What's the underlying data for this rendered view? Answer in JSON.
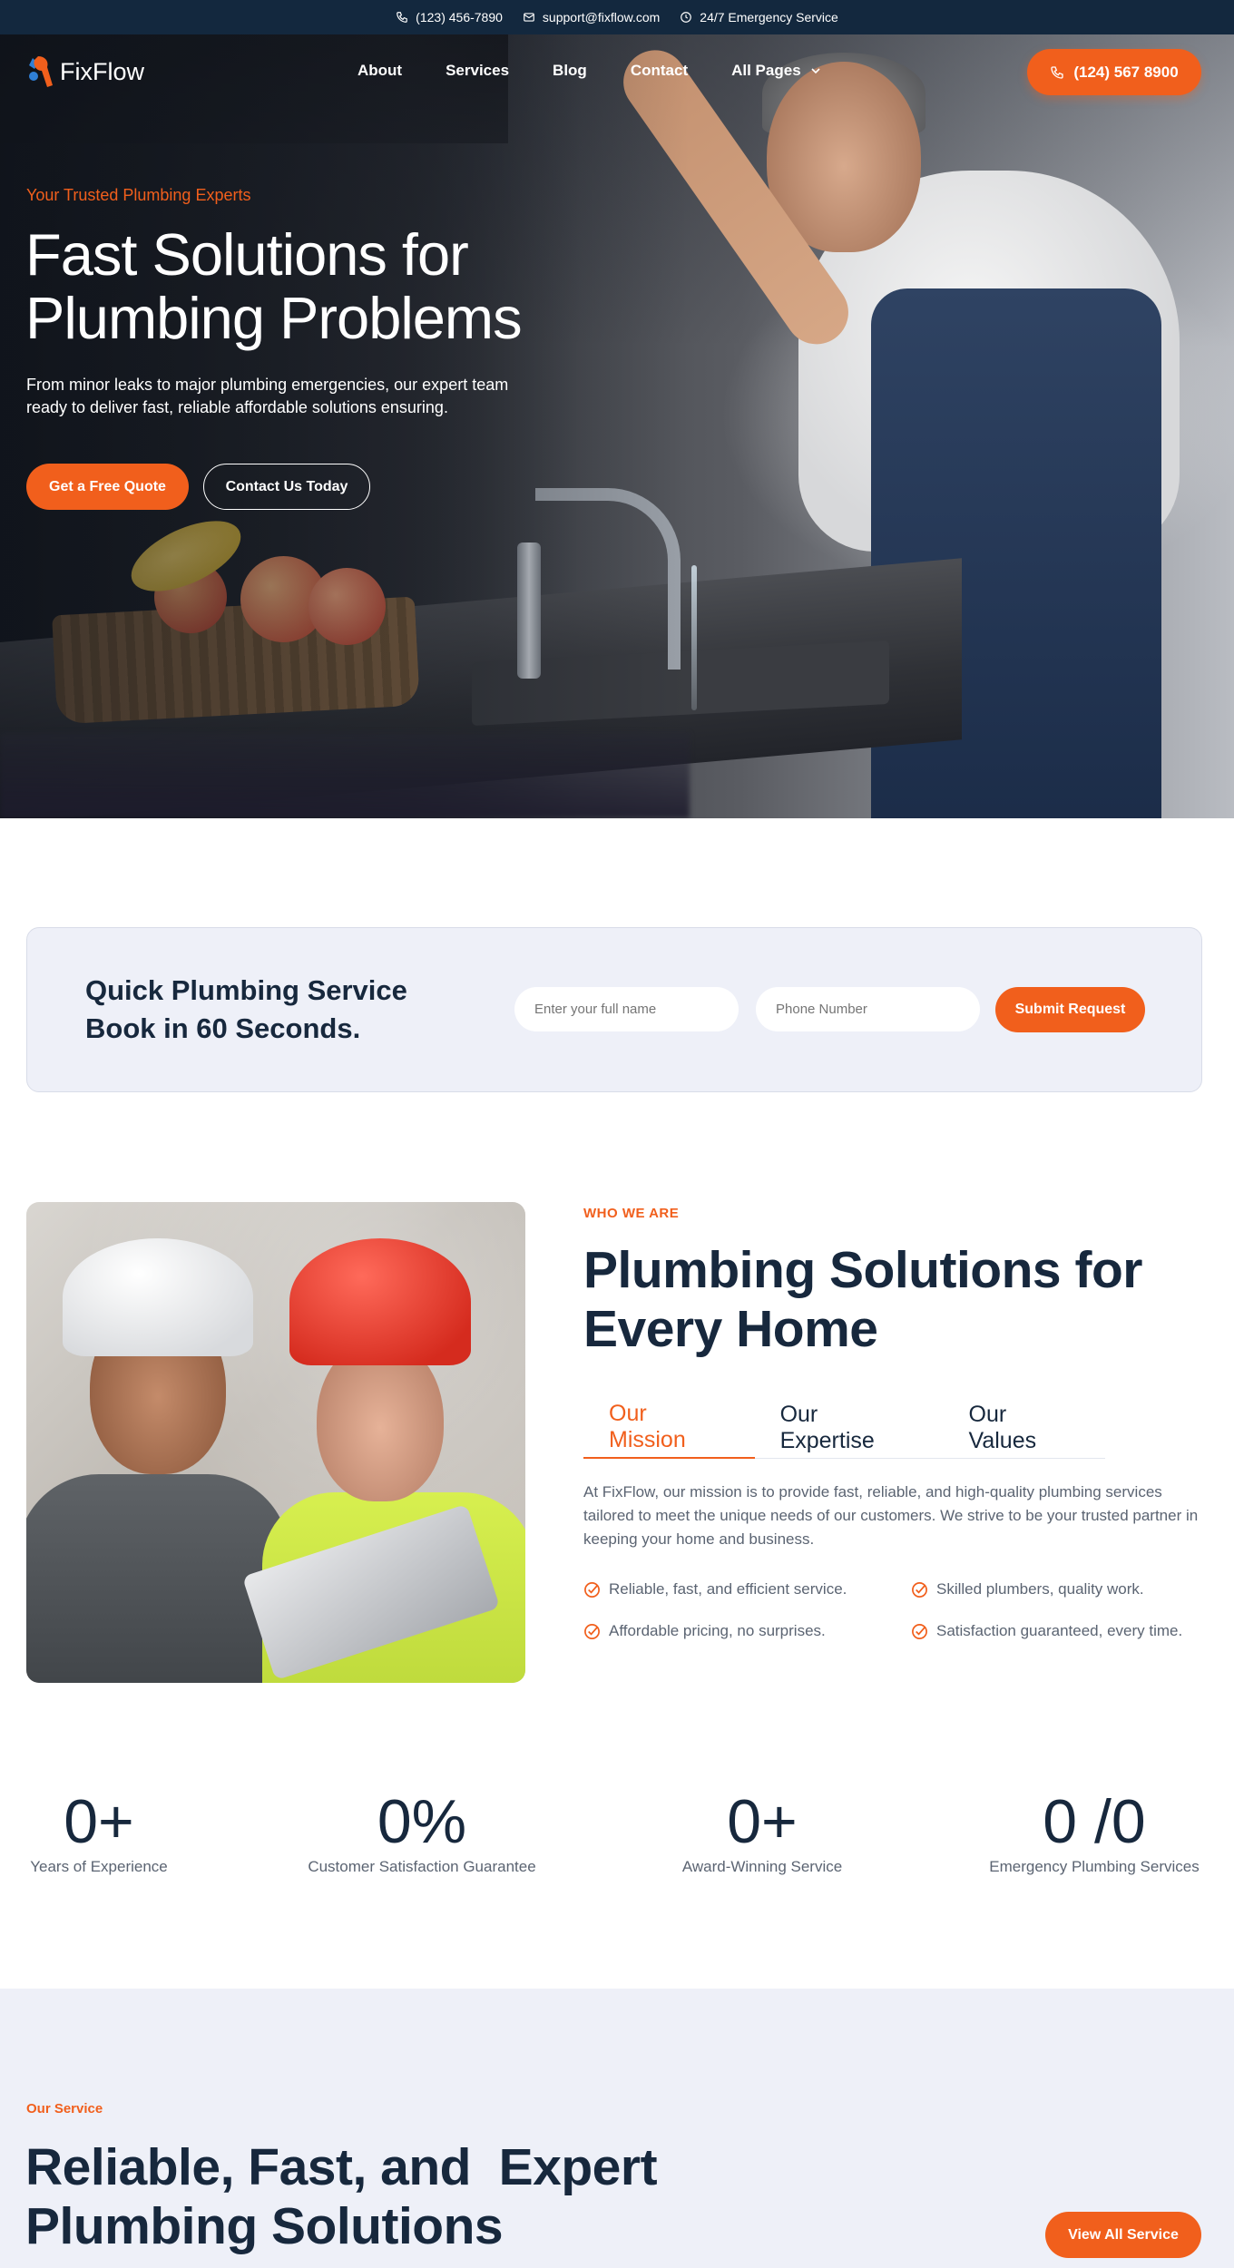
{
  "topbar": {
    "phone": "(123) 456-7890",
    "email": "support@fixflow.com",
    "hours": "24/7 Emergency Service"
  },
  "header": {
    "logo_text": "FixFlow",
    "nav": [
      "About",
      "Services",
      "Blog",
      "Contact",
      "All Pages"
    ],
    "call_button": "(124) 567 8900"
  },
  "hero": {
    "eyebrow": "Your Trusted Plumbing Experts",
    "title_line1": "Fast Solutions for",
    "title_line2": "Plumbing Problems",
    "description": "From minor leaks to major plumbing emergencies, our expert team ready to deliver fast, reliable affordable solutions ensuring.",
    "primary_button": "Get a Free Quote",
    "secondary_button": "Contact Us Today"
  },
  "quick_booking": {
    "title_line1": "Quick Plumbing Service",
    "title_line2": "Book in 60 Seconds.",
    "name_placeholder": "Enter your full name",
    "phone_placeholder": "Phone Number",
    "submit": "Submit Request"
  },
  "about": {
    "eyebrow": "WHO WE ARE",
    "title_line1": "Plumbing Solutions for",
    "title_line2": "Every Home",
    "tabs": [
      "Our Mission",
      "Our Expertise",
      "Our Values"
    ],
    "active_tab": "Our Mission",
    "text": "At FixFlow, our mission is to provide fast, reliable, and high-quality plumbing services tailored to meet the unique needs of our customers. We strive to be your trusted partner in keeping your home and business.",
    "checks": [
      "Reliable, fast, and efficient service.",
      "Skilled plumbers, quality work.",
      "Affordable pricing, no surprises.",
      "Satisfaction guaranteed, every time."
    ]
  },
  "stats": [
    {
      "value": "0+",
      "label": "Years of Experience"
    },
    {
      "value": "0%",
      "label": "Customer Satisfaction Guarantee"
    },
    {
      "value": "0+",
      "label": "Award-Winning Service"
    },
    {
      "value": "0 /0",
      "label": "Emergency Plumbing Services"
    }
  ],
  "service": {
    "eyebrow": "Our Service",
    "title_line1": "Reliable, Fast, and  Expert",
    "title_line2": "Plumbing Solutions",
    "button": "View All Service"
  },
  "colors": {
    "accent": "#f15f1c",
    "navy": "#13283e",
    "text_dark": "#17283d",
    "panel": "#eef0f8"
  }
}
